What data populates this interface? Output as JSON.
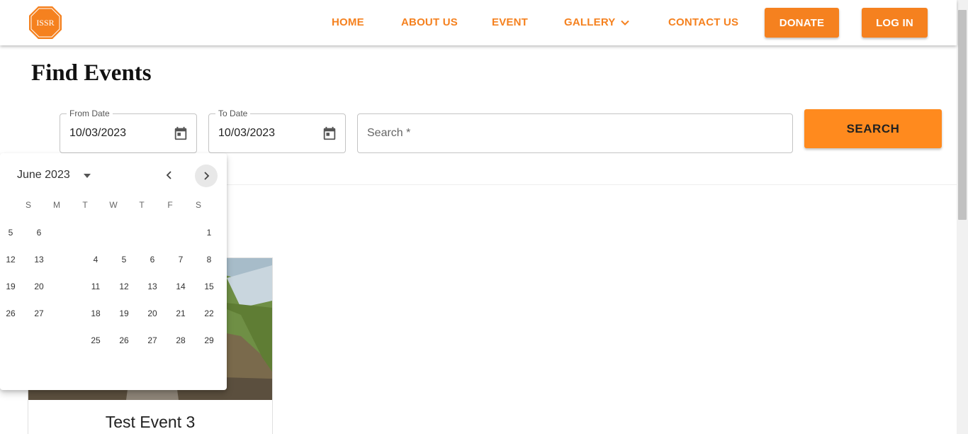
{
  "brand": {
    "logo_text": "ISSR",
    "accent": "#f5811f"
  },
  "nav": {
    "home": "HOME",
    "about": "ABOUT US",
    "event": "EVENT",
    "gallery": "GALLERY",
    "contact": "CONTACT US",
    "donate": "DONATE",
    "login": "LOG IN"
  },
  "page": {
    "title": "Find Events"
  },
  "filters": {
    "from_label": "From Date",
    "from_value": "10/03/2023",
    "to_label": "To Date",
    "to_value": "10/03/2023",
    "search_placeholder": "Search *",
    "search_button": "SEARCH"
  },
  "datepicker": {
    "month": "June 2023",
    "weekdays": [
      "S",
      "M",
      "T",
      "W",
      "T",
      "F",
      "S"
    ],
    "rows": [
      [
        "5",
        "6",
        "",
        "",
        "",
        "",
        "1"
      ],
      [
        "12",
        "13",
        "",
        "4",
        "5",
        "6",
        "7",
        "8"
      ],
      [
        "19",
        "20",
        "",
        "11",
        "12",
        "13",
        "14",
        "15"
      ],
      [
        "26",
        "27",
        "",
        "18",
        "19",
        "20",
        "21",
        "22"
      ],
      [
        "",
        "",
        "",
        "25",
        "26",
        "27",
        "28",
        "29"
      ]
    ]
  },
  "events": [
    {
      "title": "Test Event 3"
    }
  ]
}
